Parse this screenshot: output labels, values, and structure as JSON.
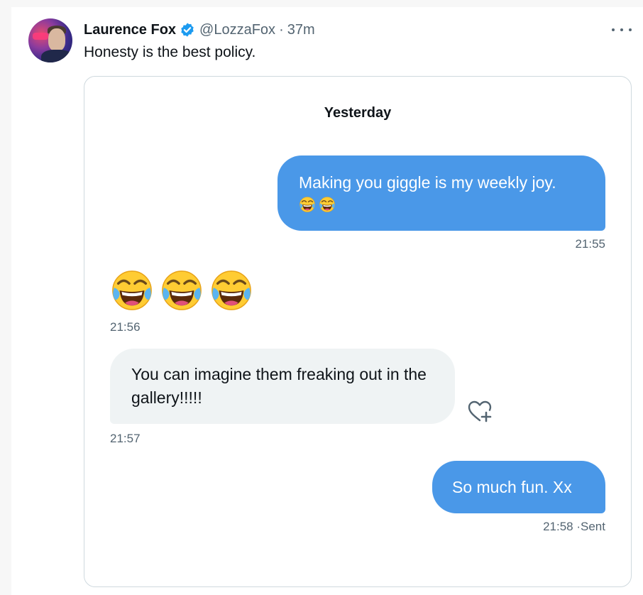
{
  "post": {
    "author_name": "Laurence Fox",
    "handle": "@LozzaFox",
    "separator": "·",
    "time_ago": "37m",
    "text": "Honesty is the best policy."
  },
  "icons": {
    "verified": "verified-badge-icon",
    "more": "more-options-icon",
    "emoji": "face-with-tears-of-joy-emoji",
    "react": "add-reaction-heart-icon"
  },
  "colors": {
    "sent_bubble": "#4a98e8",
    "received_bubble": "#eff3f4",
    "verified_blue": "#1d9bf0",
    "secondary_text": "#536471"
  },
  "conversation": {
    "date_header": "Yesterday",
    "messages": [
      {
        "direction": "sent",
        "text": "Making you giggle is my weekly joy.",
        "emoji_count": 2,
        "time": "21:55"
      },
      {
        "direction": "received",
        "text": "",
        "emoji_count": 3,
        "time": "21:56"
      },
      {
        "direction": "received",
        "text": "You can imagine them freaking out in the gallery!!!!!",
        "time": "21:57"
      },
      {
        "direction": "sent",
        "text": "So much fun. Xx",
        "time": "21:58",
        "status": "Sent"
      }
    ]
  }
}
